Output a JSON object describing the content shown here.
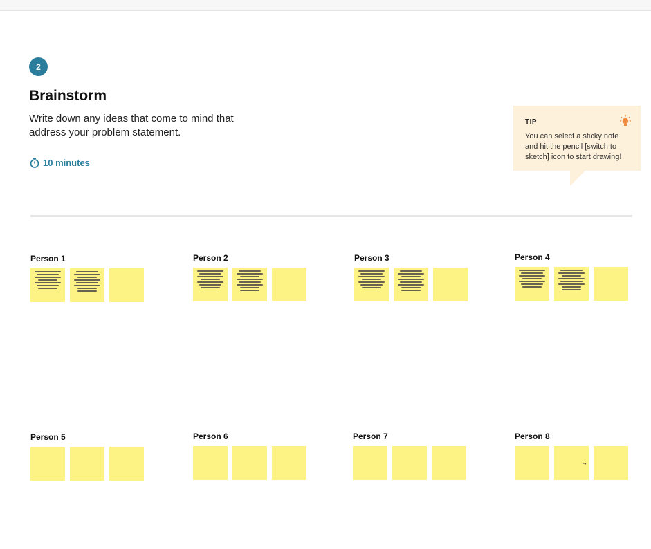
{
  "activity": {
    "step_number": "2",
    "title": "Brainstorm",
    "description": "Write down any ideas that come to mind that address your problem statement.",
    "timer": "10 minutes"
  },
  "tip": {
    "label": "TIP",
    "text": "You can select a sticky note and hit the pencil [switch to sketch] icon to start drawing!"
  },
  "people": [
    {
      "name": "Person 1",
      "notes": [
        "filled",
        "filled",
        "empty"
      ]
    },
    {
      "name": "Person 2",
      "notes": [
        "filled",
        "filled",
        "empty"
      ]
    },
    {
      "name": "Person 3",
      "notes": [
        "filled",
        "filled",
        "empty"
      ]
    },
    {
      "name": "Person 4",
      "notes": [
        "filled",
        "filled",
        "empty"
      ]
    },
    {
      "name": "Person 5",
      "notes": [
        "empty",
        "empty",
        "empty"
      ]
    },
    {
      "name": "Person 6",
      "notes": [
        "empty",
        "empty",
        "empty"
      ]
    },
    {
      "name": "Person 7",
      "notes": [
        "empty",
        "empty",
        "empty"
      ]
    },
    {
      "name": "Person 8",
      "notes": [
        "empty",
        "empty",
        "empty"
      ]
    }
  ],
  "colors": {
    "accent": "#2a7e9c",
    "sticky_note": "#fdf284",
    "tip_background": "#fdf1dc",
    "bulb": "#f08a3c"
  },
  "icons": {
    "timer": "stopwatch-icon",
    "tip": "lightbulb-icon",
    "cursor": "arrow-right-icon"
  }
}
